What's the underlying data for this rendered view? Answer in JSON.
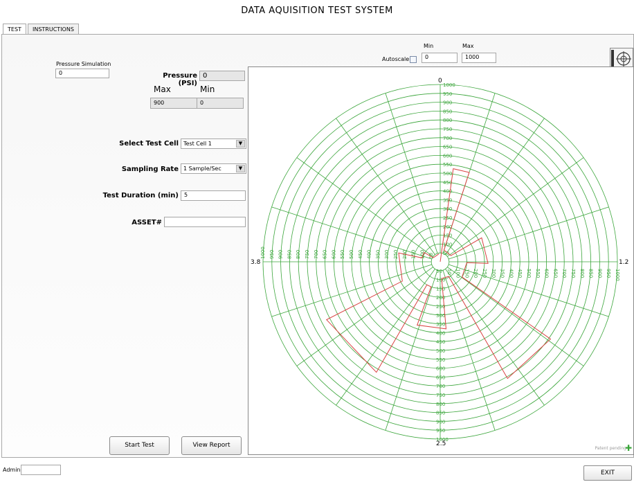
{
  "window_title": "DATA AQUISITION TEST SYSTEM",
  "tabs": [
    {
      "label": "TEST",
      "active": true
    },
    {
      "label": "INSTRUCTIONS",
      "active": false
    }
  ],
  "controls": {
    "pressure_simulation_label": "Pressure Simulation",
    "pressure_simulation_value": "0",
    "pressure_label": "Pressure (PSI)",
    "pressure_value": "0",
    "max_label": "Max",
    "min_label": "Min",
    "max_value": "900",
    "min_value": "0",
    "select_test_cell_label": "Select Test Cell",
    "select_test_cell_value": "Test Cell 1",
    "sampling_rate_label": "Sampling Rate",
    "sampling_rate_value": "1 Sample/Sec",
    "test_duration_label": "Test Duration (min)",
    "test_duration_value": "5",
    "asset_label": "ASSET#",
    "asset_value": "",
    "start_test_label": "Start Test",
    "view_report_label": "View Report"
  },
  "chart_controls": {
    "autoscale_label": "Autoscale",
    "autoscale_checked": false,
    "min_label": "Min",
    "max_label": "Max",
    "min_value": "0",
    "max_value": "1000",
    "crosshair_icon": "crosshair-icon"
  },
  "footer": {
    "admin_label": "Admin",
    "admin_value": "",
    "exit_label": "EXIT",
    "corner_note": "Patent pending"
  },
  "colors": {
    "grid": "#3aa53a",
    "trace": "#d94040",
    "tick_text": "#3aa53a"
  },
  "chart_data": {
    "type": "polar-line",
    "axis_labels": {
      "top": "0",
      "right": "1.2",
      "bottom": "2.5",
      "left": "3.8"
    },
    "r_range": [
      0,
      1000
    ],
    "r_ticks": [
      0,
      50,
      100,
      150,
      200,
      250,
      300,
      350,
      400,
      450,
      500,
      550,
      600,
      650,
      700,
      750,
      800,
      850,
      900,
      950,
      1000
    ],
    "spokes": 20,
    "grid": true,
    "series": [
      {
        "points": [
          {
            "angle_deg": 0,
            "r": 0
          },
          {
            "angle_deg": 8,
            "r": 530
          },
          {
            "angle_deg": 18,
            "r": 530
          },
          {
            "angle_deg": 18,
            "r": 70
          },
          {
            "angle_deg": 60,
            "r": 70
          },
          {
            "angle_deg": 60,
            "r": 270
          },
          {
            "angle_deg": 92,
            "r": 270
          },
          {
            "angle_deg": 92,
            "r": 150
          },
          {
            "angle_deg": 125,
            "r": 150
          },
          {
            "angle_deg": 125,
            "r": 760
          },
          {
            "angle_deg": 150,
            "r": 760
          },
          {
            "angle_deg": 150,
            "r": 95
          },
          {
            "angle_deg": 175,
            "r": 95
          },
          {
            "angle_deg": 175,
            "r": 380
          },
          {
            "angle_deg": 200,
            "r": 380
          },
          {
            "angle_deg": 200,
            "r": 150
          },
          {
            "angle_deg": 210,
            "r": 150
          },
          {
            "angle_deg": 210,
            "r": 720
          },
          {
            "angle_deg": 243,
            "r": 720
          },
          {
            "angle_deg": 243,
            "r": 240
          },
          {
            "angle_deg": 282,
            "r": 240
          },
          {
            "angle_deg": 282,
            "r": 105
          },
          {
            "angle_deg": 300,
            "r": 105
          },
          {
            "angle_deg": 300,
            "r": 45
          },
          {
            "angle_deg": 350,
            "r": 45
          }
        ]
      }
    ]
  }
}
